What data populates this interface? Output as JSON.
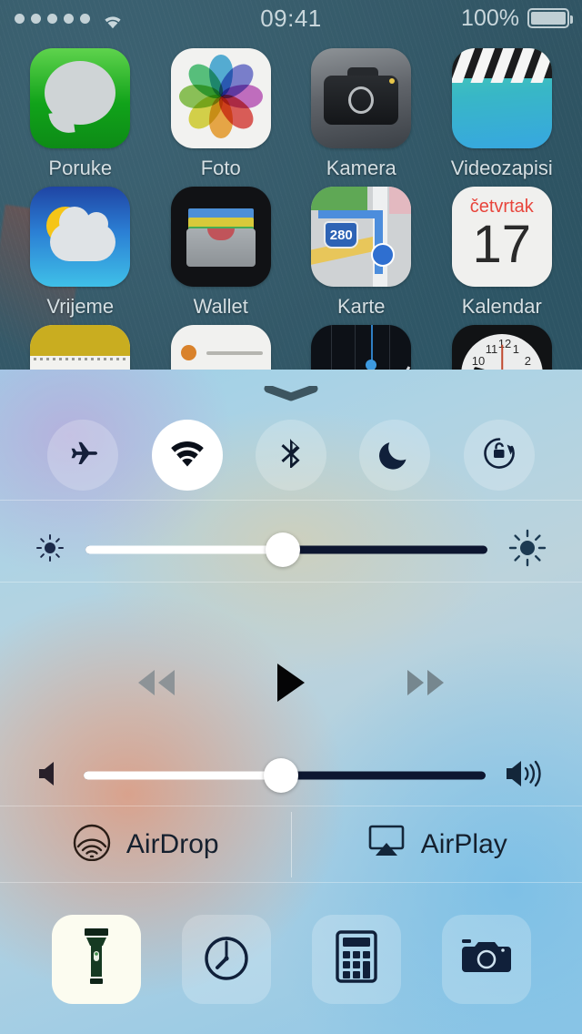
{
  "status_bar": {
    "signal_dots": 5,
    "wifi_icon": "wifi-icon",
    "time": "09:41",
    "battery_percent": "100%",
    "battery_icon": "battery-full-icon"
  },
  "home_screen": {
    "apps": [
      {
        "label": "Poruke",
        "icon": "messages-icon"
      },
      {
        "label": "Foto",
        "icon": "photos-icon"
      },
      {
        "label": "Kamera",
        "icon": "camera-icon"
      },
      {
        "label": "Videozapisi",
        "icon": "videos-icon"
      },
      {
        "label": "Vrijeme",
        "icon": "weather-icon"
      },
      {
        "label": "Wallet",
        "icon": "wallet-icon"
      },
      {
        "label": "Karte",
        "icon": "maps-icon"
      },
      {
        "label": "Kalendar",
        "icon": "calendar-icon"
      }
    ],
    "partial_apps": [
      {
        "label": "",
        "icon": "notes-icon"
      },
      {
        "label": "",
        "icon": "reminders-icon"
      },
      {
        "label": "",
        "icon": "stocks-icon"
      },
      {
        "label": "",
        "icon": "clock-icon"
      }
    ],
    "maps_route_shield": "280",
    "calendar_weekday": "četvrtak",
    "calendar_day": "17"
  },
  "control_center": {
    "grabber": "chevron-down-grabber",
    "toggles": [
      {
        "name": "airplane-mode",
        "icon": "airplane-icon",
        "active": false
      },
      {
        "name": "wifi",
        "icon": "wifi-icon",
        "active": true
      },
      {
        "name": "bluetooth",
        "icon": "bluetooth-icon",
        "active": false
      },
      {
        "name": "do-not-disturb",
        "icon": "moon-icon",
        "active": false
      },
      {
        "name": "rotation-lock",
        "icon": "rotation-lock-icon",
        "active": false
      }
    ],
    "brightness": {
      "value": 49,
      "min_icon": "sun-small-icon",
      "max_icon": "sun-large-icon"
    },
    "media": {
      "rewind_icon": "rewind-icon",
      "play_icon": "play-icon",
      "forward_icon": "fast-forward-icon"
    },
    "volume": {
      "value": 49,
      "min_icon": "speaker-mute-icon",
      "max_icon": "speaker-waves-icon"
    },
    "share": {
      "airdrop_label": "AirDrop",
      "airdrop_icon": "airdrop-icon",
      "airplay_label": "AirPlay",
      "airplay_icon": "airplay-icon"
    },
    "shortcuts": [
      {
        "name": "flashlight",
        "icon": "flashlight-icon",
        "active": true
      },
      {
        "name": "timer",
        "icon": "timer-icon",
        "active": false
      },
      {
        "name": "calculator",
        "icon": "calculator-icon",
        "active": false
      },
      {
        "name": "camera",
        "icon": "camera-icon",
        "active": false
      }
    ]
  },
  "colors": {
    "accent_active": "#ffffff",
    "icon_dark": "#0e1a2e",
    "wallpaper": "#2d4f5e",
    "messages_green": "#11a31a",
    "calendar_red": "#e8453c"
  }
}
